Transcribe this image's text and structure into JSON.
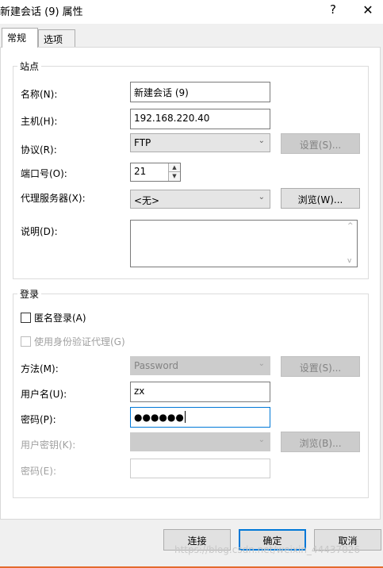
{
  "window": {
    "title": "新建会话 (9) 属性",
    "help": "?",
    "close": "✕"
  },
  "tabs": [
    {
      "label": "常规",
      "active": true
    },
    {
      "label": "选项",
      "active": false
    }
  ],
  "site": {
    "legend": "站点",
    "name_label": "名称(N):",
    "name_value": "新建会话 (9)",
    "host_label": "主机(H):",
    "host_value": "192.168.220.40",
    "protocol_label": "协议(R):",
    "protocol_value": "FTP",
    "protocol_settings": "设置(S)...",
    "port_label": "端口号(O):",
    "port_value": "21",
    "proxy_label": "代理服务器(X):",
    "proxy_value": "<无>",
    "proxy_browse": "浏览(W)...",
    "desc_label": "说明(D):",
    "desc_value": ""
  },
  "login": {
    "legend": "登录",
    "anonymous_label": "匿名登录(A)",
    "anonymous_checked": false,
    "agent_label": "使用身份验证代理(G)",
    "agent_checked": false,
    "method_label": "方法(M):",
    "method_value": "Password",
    "method_settings": "设置(S)...",
    "user_label": "用户名(U):",
    "user_value": "zx",
    "password_label": "密码(P):",
    "password_value": "●●●●●●",
    "userkey_label": "用户密钥(K):",
    "userkey_value": "",
    "userkey_browse": "浏览(B)...",
    "passphrase_label": "密码(E):",
    "passphrase_value": ""
  },
  "footer": {
    "connect": "连接",
    "ok": "确定",
    "cancel": "取消"
  },
  "watermark": "https://blog.csdn.net/weixin_44437026",
  "colors": {
    "accent": "#0078d7",
    "bottom_strip": "#e46b2e"
  }
}
